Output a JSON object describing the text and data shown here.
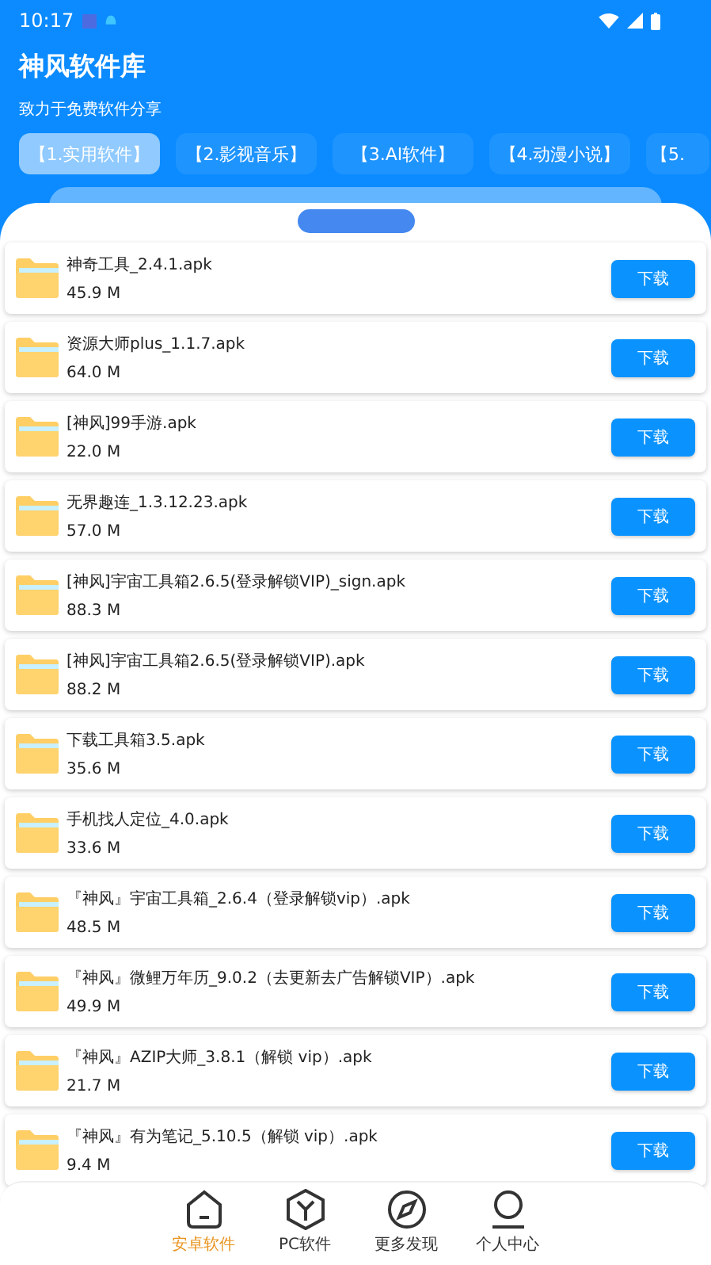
{
  "status_bar": {
    "time": "10:17"
  },
  "header": {
    "title": "神风软件库",
    "subtitle": "致力于免费软件分享"
  },
  "tabs": [
    {
      "label": "【1.实用软件】",
      "selected": true
    },
    {
      "label": "【2.影视音乐】",
      "selected": false
    },
    {
      "label": "【3.AI软件】",
      "selected": false
    },
    {
      "label": "【4.动漫小说】",
      "selected": false
    },
    {
      "label": "【5.",
      "selected": false
    }
  ],
  "files": [
    {
      "name": "神奇工具_2.4.1.apk",
      "size": "45.9 M",
      "button": "下载"
    },
    {
      "name": "资源大师plus_1.1.7.apk",
      "size": "64.0 M",
      "button": "下载"
    },
    {
      "name": "[神风]99手游.apk",
      "size": "22.0 M",
      "button": "下载"
    },
    {
      "name": "无界趣连_1.3.12.23.apk",
      "size": "57.0 M",
      "button": "下载"
    },
    {
      "name": " [神风]宇宙工具箱2.6.5(登录解锁VIP)_sign.apk",
      "size": "88.3 M",
      "button": "下载"
    },
    {
      "name": "[神风]宇宙工具箱2.6.5(登录解锁VIP).apk",
      "size": "88.2 M",
      "button": "下载"
    },
    {
      "name": "下载工具箱3.5.apk",
      "size": "35.6 M",
      "button": "下载"
    },
    {
      "name": "手机找人定位_4.0.apk",
      "size": "33.6 M",
      "button": "下载"
    },
    {
      "name": "『神风』宇宙工具箱_2.6.4（登录解锁vip）.apk",
      "size": "48.5 M",
      "button": "下载"
    },
    {
      "name": "『神风』微鲤万年历_9.0.2（去更新去广告解锁VIP）.apk",
      "size": "49.9 M",
      "button": "下载"
    },
    {
      "name": "『神风』AZIP大师_3.8.1（解锁 vip）.apk",
      "size": "21.7 M",
      "button": "下载"
    },
    {
      "name": "『神风』有为笔记_5.10.5（解锁 vip）.apk",
      "size": "9.4 M",
      "button": "下载"
    }
  ],
  "bottom_nav": [
    {
      "kind": "home",
      "label": "安卓软件",
      "selected": true
    },
    {
      "kind": "hexagon",
      "label": "PC软件",
      "selected": false
    },
    {
      "kind": "compass",
      "label": "更多发现",
      "selected": false
    },
    {
      "kind": "person",
      "label": "个人中心",
      "selected": false
    }
  ]
}
